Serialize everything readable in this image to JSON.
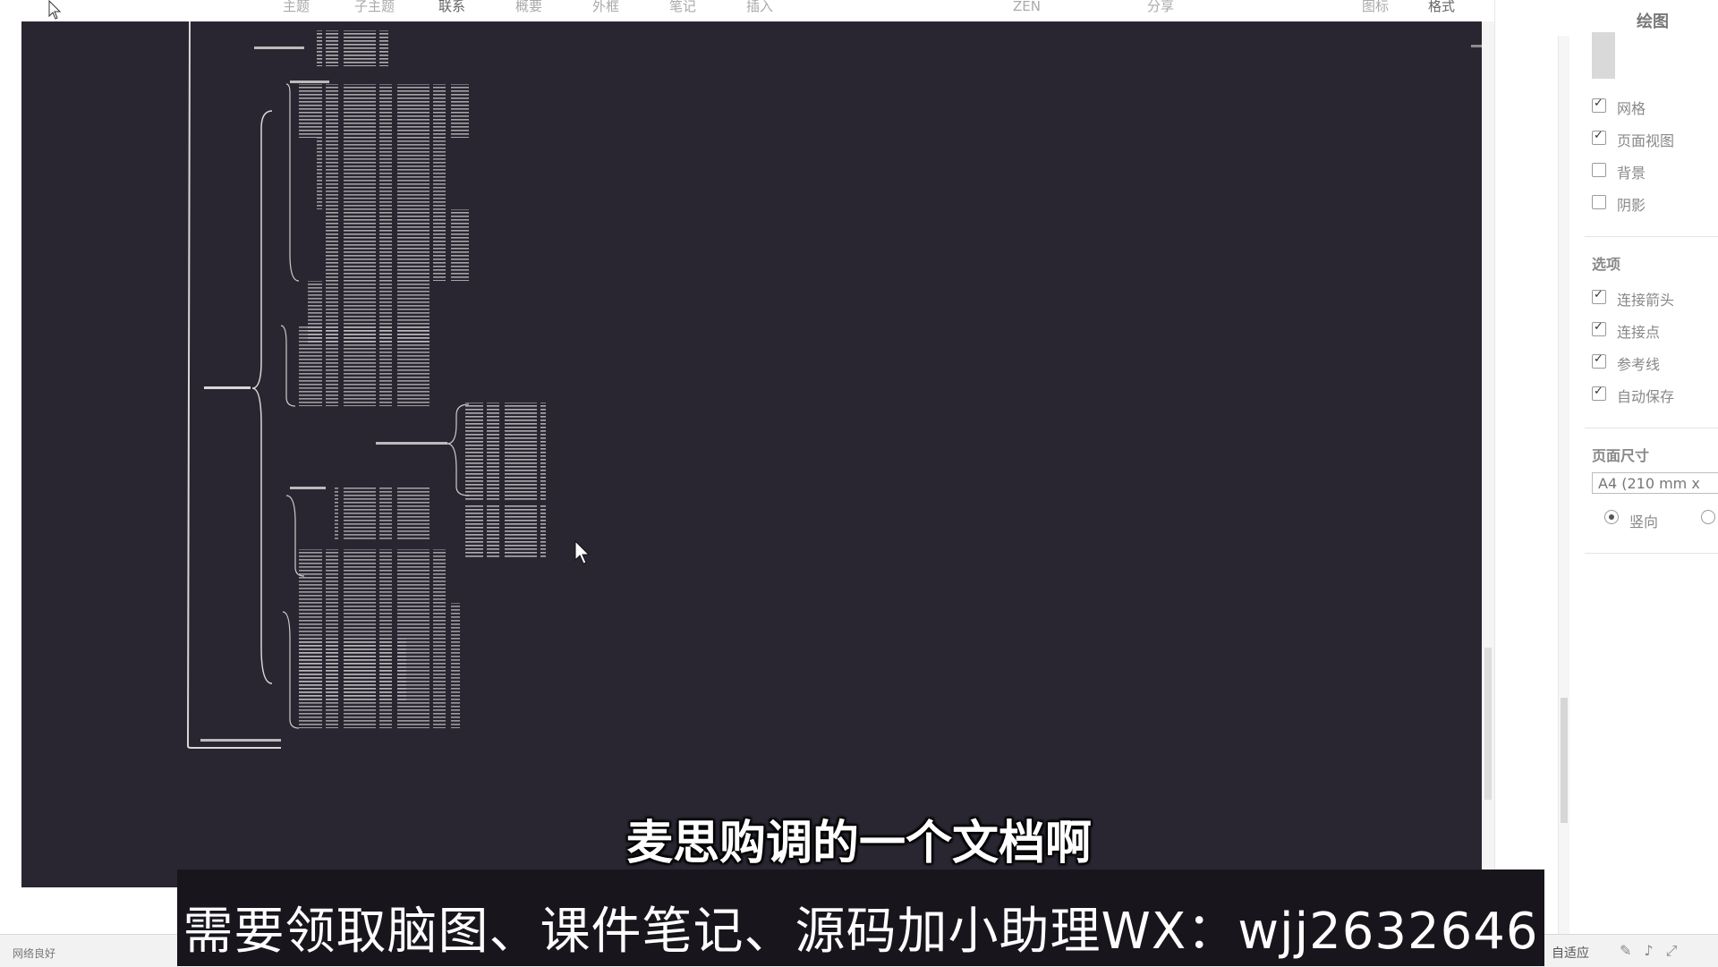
{
  "toolbar": {
    "items": [
      {
        "label": "主题",
        "active": false
      },
      {
        "label": "子主题",
        "active": false
      },
      {
        "label": "联系",
        "active": true
      },
      {
        "label": "概要",
        "active": false
      },
      {
        "label": "外框",
        "active": false
      },
      {
        "label": "笔记",
        "active": false
      },
      {
        "label": "插入",
        "active": false
      },
      {
        "label": "ZEN",
        "active": false
      },
      {
        "label": "分享",
        "active": false
      },
      {
        "label": "图标",
        "active": false
      },
      {
        "label": "格式",
        "active": false
      }
    ]
  },
  "panel": {
    "title": "绘图",
    "view_options": [
      {
        "label": "网格",
        "checked": true
      },
      {
        "label": "页面视图",
        "checked": true
      },
      {
        "label": "背景",
        "checked": false
      },
      {
        "label": "阴影",
        "checked": false
      }
    ],
    "options_header": "选项",
    "options": [
      {
        "label": "连接箭头",
        "checked": true
      },
      {
        "label": "连接点",
        "checked": true
      },
      {
        "label": "参考线",
        "checked": true
      },
      {
        "label": "自动保存",
        "checked": true
      }
    ],
    "page_size_header": "页面尺寸",
    "page_size_value": "A4 (210 mm x",
    "orientation_label": "竖向"
  },
  "statusbar": {
    "left_text": "网络良好",
    "right_text": "自适应"
  },
  "subtitles": {
    "line1": "麦思购调的一个文档啊",
    "banner": "需要领取脑图、课件笔记、源码加小助理WX：wjj2632646"
  },
  "colors": {
    "canvas_bg": "#2a2631",
    "mindmap_line": "#d8d8d8"
  }
}
